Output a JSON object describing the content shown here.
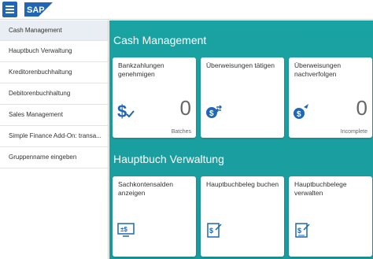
{
  "header": {
    "menu_icon": "hamburger-icon",
    "logo_text": "SAP",
    "logo_color": "#1f67b4"
  },
  "sidebar": {
    "items": [
      {
        "label": "Cash Management"
      },
      {
        "label": "Hauptbuch Verwaltung"
      },
      {
        "label": "Kreditorenbuchhaltung"
      },
      {
        "label": "Debitorenbuchhaltung"
      },
      {
        "label": "Sales Management"
      },
      {
        "label": "Simple Finance Add-On: transa..."
      },
      {
        "label": "Gruppenname eingeben"
      }
    ]
  },
  "groups": [
    {
      "title": "Cash Management",
      "tiles": [
        {
          "title": "Bankzahlungen genehmigen",
          "number": "0",
          "unit": "Batches",
          "icon": "dollar-check-icon"
        },
        {
          "title": "Überweisungen tätigen",
          "icon": "money-transfer-icon"
        },
        {
          "title": "Überweisungen nachverfolgen",
          "number": "0",
          "unit": "Incomplete",
          "icon": "money-track-icon"
        }
      ]
    },
    {
      "title": "Hauptbuch Verwaltung",
      "tiles": [
        {
          "title": "Sachkontensalden anzeigen",
          "icon": "account-balance-icon"
        },
        {
          "title": "Hauptbuchbeleg buchen",
          "icon": "post-document-icon"
        },
        {
          "title": "Hauptbuchbelege verwalten",
          "icon": "manage-documents-icon"
        }
      ]
    }
  ],
  "colors": {
    "accent_teal": "#1aa3a3",
    "icon_blue": "#1f67b4"
  }
}
